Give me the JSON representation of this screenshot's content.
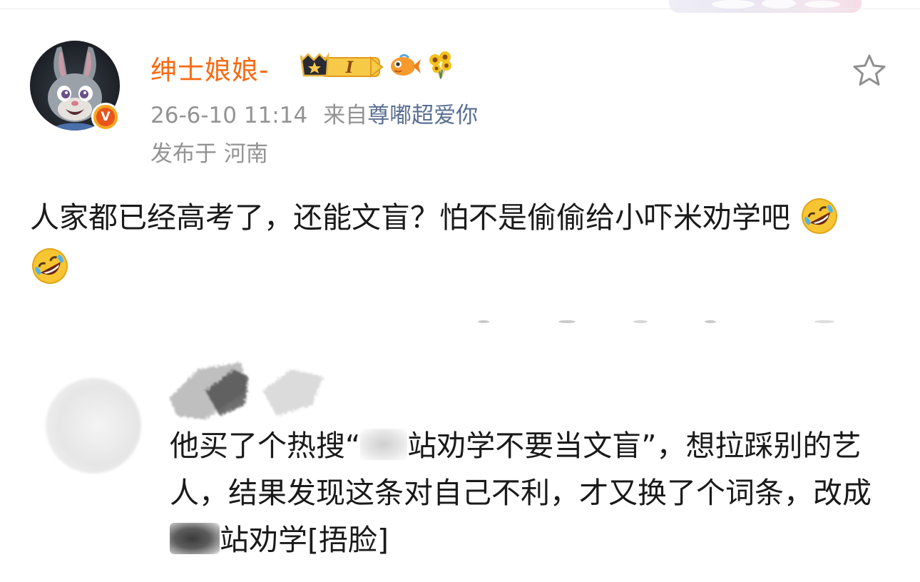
{
  "post": {
    "author": {
      "name": "绅士娘娘-",
      "level_badge_text": "I",
      "verified": "V"
    },
    "timestamp": "26-6-10 11:14",
    "source_prefix": "来自",
    "source_name": "尊嘟超爱你",
    "location_prefix": "发布于",
    "location": "河南",
    "content": "人家都已经高考了，还能文盲？怕不是偷偷给小吓米劝学吧",
    "content_emojis": [
      "rofl-emoji",
      "rofl-emoji"
    ]
  },
  "quoted_comment": {
    "text_part_1": "他买了个热搜“",
    "text_part_2": "站劝学不要当文盲”，想拉踩别的艺人，结果发现这条对自己不利，才又换了个词条，改成",
    "text_part_3": "站劝学[捂脸]"
  },
  "colors": {
    "username": "#f76b14",
    "meta": "#939393",
    "source_link": "#5a6f93",
    "body_text": "#1a1a1a",
    "verified_badge": "#f6a623"
  }
}
